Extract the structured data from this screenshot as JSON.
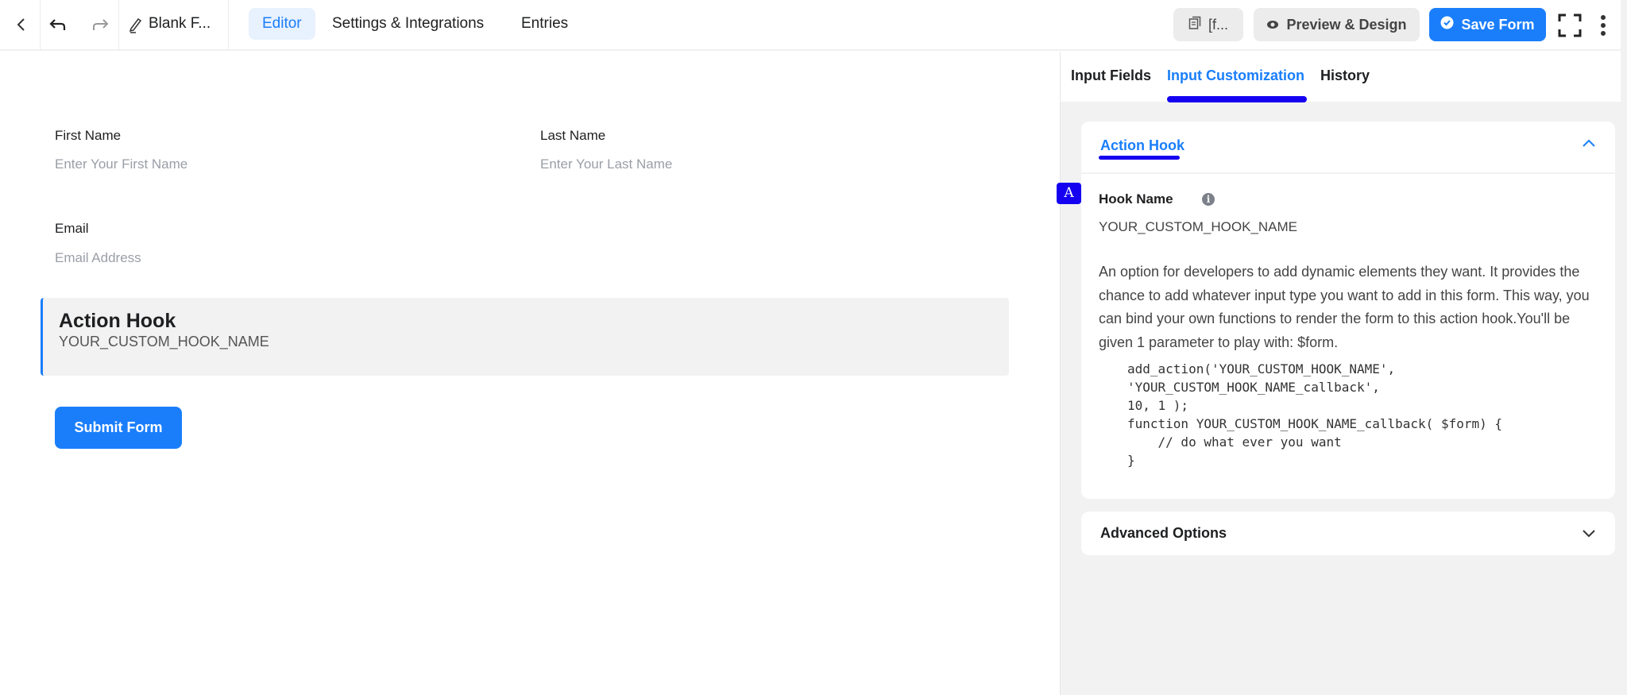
{
  "topbar": {
    "form_title": "Blank F...",
    "tabs": [
      "Editor",
      "Settings & Integrations",
      "Entries"
    ],
    "shortcode_label": "[f...",
    "preview_label": "Preview & Design",
    "save_label": "Save Form"
  },
  "form": {
    "first_name_label": "First Name",
    "first_name_placeholder": "Enter Your First Name",
    "last_name_label": "Last Name",
    "last_name_placeholder": "Enter Your Last Name",
    "email_label": "Email",
    "email_placeholder": "Email Address",
    "hook_title": "Action Hook",
    "hook_name": "YOUR_CUSTOM_HOOK_NAME",
    "submit_label": "Submit Form"
  },
  "panel": {
    "tabs": [
      "Input Fields",
      "Input Customization",
      "History"
    ],
    "section_title": "Action Hook",
    "badge": "A",
    "hook_name_label": "Hook Name",
    "hook_name_value": "YOUR_CUSTOM_HOOK_NAME",
    "description": "An option for developers to add dynamic elements they want. It provides the chance to add whatever input type you want to add in this form. This way, you can bind your own functions to render the form to this action hook.You'll be given 1 parameter to play with: $form.",
    "code": "add_action('YOUR_CUSTOM_HOOK_NAME',\n'YOUR_CUSTOM_HOOK_NAME_callback',\n10, 1 );\nfunction YOUR_CUSTOM_HOOK_NAME_callback( $form) {\n    // do what ever you want\n}",
    "advanced_label": "Advanced Options"
  },
  "colors": {
    "accent": "#1a7efb",
    "marker": "#1500f0"
  }
}
